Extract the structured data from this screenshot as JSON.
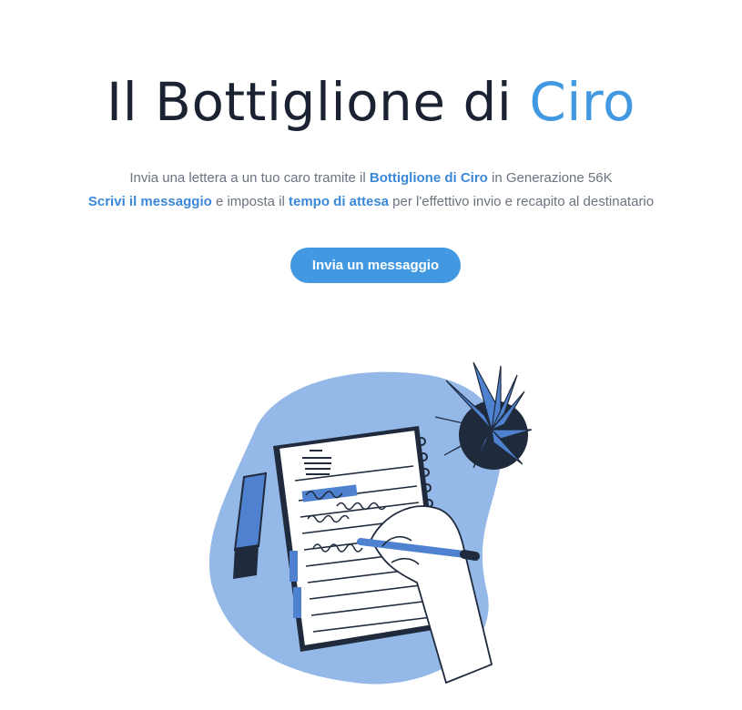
{
  "hero": {
    "title_main": "Il Bottiglione di ",
    "title_accent": "Ciro",
    "line1_pre": "Invia una lettera a un tuo caro tramite il ",
    "line1_bold": "Bottiglione di Ciro",
    "line1_post": " in Generazione 56K",
    "line2_bold1": "Scrivi il messaggio",
    "line2_mid": " e imposta il ",
    "line2_bold2": "tempo di attesa",
    "line2_post": " per l'effettivo invio e recapito al destinatario",
    "cta_label": "Invia un messaggio"
  },
  "colors": {
    "accent": "#4299e1",
    "title": "#1b2333",
    "text": "#6b7280",
    "blob": "#94b8e8",
    "ink": "#1f2a3c"
  },
  "illustration": {
    "icon": "letter-writing-illustration"
  }
}
